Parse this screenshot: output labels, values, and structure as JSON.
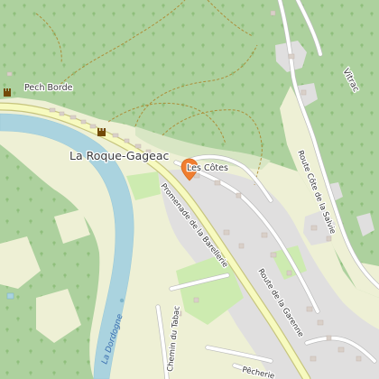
{
  "map": {
    "style": "openstreetmap",
    "colors": {
      "forest": "#add19e",
      "farmland": "#eef0d5",
      "meadow": "#cdebb0",
      "village": "#e0dfdf",
      "water": "#aad3df",
      "main_road": "#f7fabf",
      "main_road_casing": "#c6c47d",
      "pin": "#f07d30"
    },
    "labels": {
      "town": "La Roque-Gageac",
      "hamlet_pech": "Pech Borde",
      "hamlet_cotes": "Les Côtes",
      "promenade": "Promenade de la Barellerie",
      "route_garenne": "Route de la Garenne",
      "route_cote": "Route Côte de la Salvie",
      "chemin_tabac": "Chemin du Tabac",
      "pecherie": "Pêcherie",
      "river": "La Dordogne",
      "vitrac": "Vitrac"
    },
    "icons": [
      "castle-icon",
      "castle-icon",
      "location-pin-icon",
      "waterway-marker-icon"
    ]
  }
}
